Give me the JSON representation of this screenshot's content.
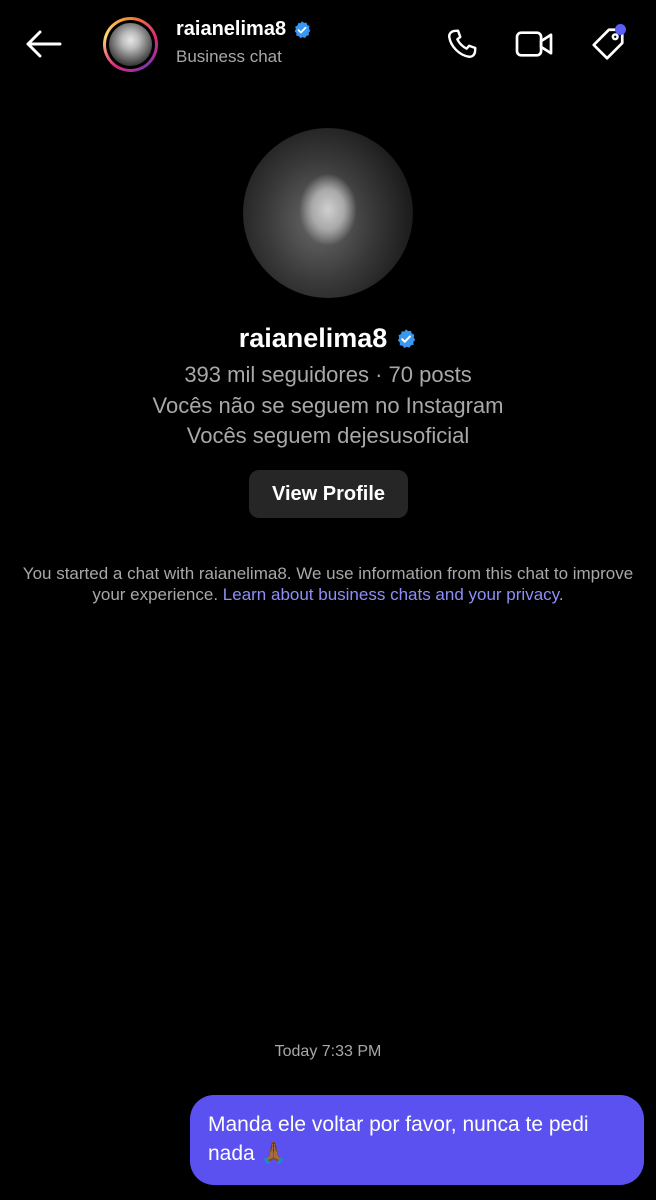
{
  "header": {
    "username": "raianelima8",
    "subtitle": "Business chat",
    "icons": {
      "back": "arrow-left-icon",
      "call": "phone-icon",
      "video": "video-camera-icon",
      "tag": "tag-icon",
      "verified": "verified-badge-icon"
    },
    "badge_color": "#5b5ef4"
  },
  "profile": {
    "name": "raianelima8",
    "stats": "393 mil seguidores · 70 posts",
    "follow_status": "Vocês não se seguem no Instagram",
    "mutual": "Vocês seguem dejesusoficial",
    "view_profile_label": "View Profile"
  },
  "notice": {
    "text": "You started a chat with raianelima8. We use information from this chat to improve your experience.",
    "link": "Learn about business chats and your privacy",
    "end": "."
  },
  "messages": {
    "timestamp": "Today 7:33 PM",
    "items": [
      {
        "text": "Manda ele voltar por favor, nunca te pedi nada 🙏🏾",
        "sent": true
      }
    ]
  },
  "colors": {
    "background": "#000000",
    "bubble": "#5b50f0",
    "link": "#8d8ff7",
    "verified": "#3897f0",
    "muted_text": "#a8a8a8"
  }
}
